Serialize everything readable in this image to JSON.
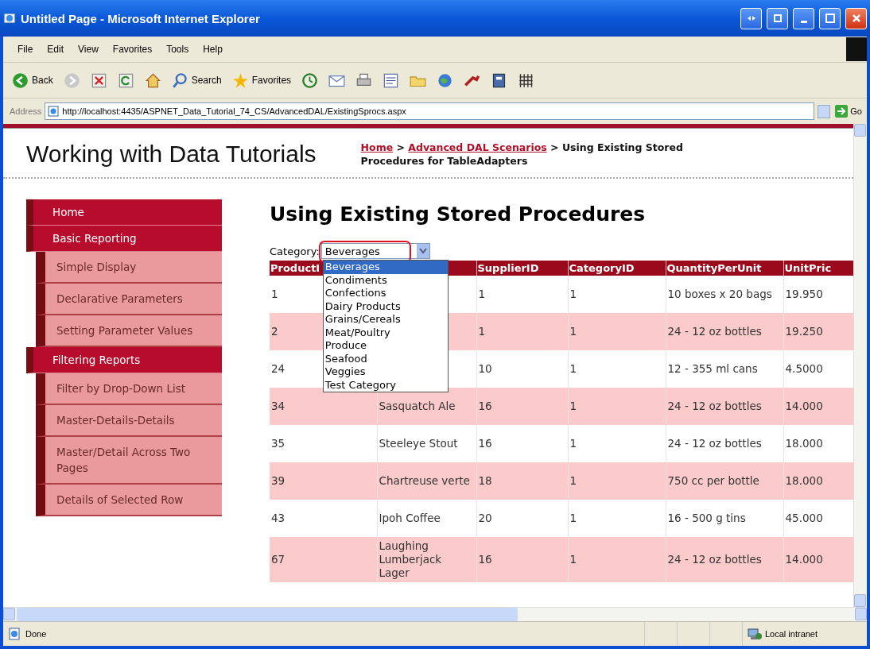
{
  "window": {
    "title": "Untitled Page - Microsoft Internet Explorer"
  },
  "menu": [
    "File",
    "Edit",
    "View",
    "Favorites",
    "Tools",
    "Help"
  ],
  "toolbar": [
    {
      "kind": "back",
      "label": "Back"
    },
    {
      "kind": "forward"
    },
    {
      "kind": "stop"
    },
    {
      "kind": "refresh"
    },
    {
      "kind": "home"
    },
    {
      "kind": "search",
      "label": "Search"
    },
    {
      "kind": "favorites",
      "label": "Favorites"
    },
    {
      "kind": "history"
    },
    {
      "kind": "mail"
    },
    {
      "kind": "print"
    },
    {
      "kind": "edit"
    },
    {
      "kind": "folder"
    },
    {
      "kind": "globe"
    },
    {
      "kind": "tool"
    },
    {
      "kind": "book"
    },
    {
      "kind": "grid"
    }
  ],
  "address": {
    "label": "Address",
    "url": "http://localhost:4435/ASPNET_Data_Tutorial_74_CS/AdvancedDAL/ExistingSprocs.aspx",
    "go": "Go"
  },
  "page": {
    "site_title": "Working with Data Tutorials",
    "breadcrumb": [
      {
        "kind": "link",
        "text": "Home"
      },
      {
        "kind": "text",
        "text": " > "
      },
      {
        "kind": "link",
        "text": "Advanced DAL Scenarios"
      },
      {
        "kind": "text",
        "text": " > Using Existing Stored Procedures for TableAdapters"
      }
    ],
    "sidebar": [
      {
        "label": "Home"
      },
      {
        "label": "Basic Reporting",
        "children": [
          {
            "label": "Simple Display"
          },
          {
            "label": "Declarative Parameters"
          },
          {
            "label": "Setting Parameter Values"
          }
        ]
      },
      {
        "label": "Filtering Reports",
        "children": [
          {
            "label": "Filter by Drop-Down List"
          },
          {
            "label": "Master-Details-Details"
          },
          {
            "label": "Master/Detail Across Two Pages"
          },
          {
            "label": "Details of Selected Row"
          }
        ]
      }
    ],
    "heading": "Using Existing Stored Procedures",
    "filter": {
      "label": "Category:",
      "value": "Beverages",
      "expanded": true,
      "options": [
        {
          "label": "Beverages",
          "selected": true
        },
        {
          "label": "Condiments",
          "selected": false
        },
        {
          "label": "Confections",
          "selected": false
        },
        {
          "label": "Dairy Products",
          "selected": false
        },
        {
          "label": "Grains/Cereals",
          "selected": false
        },
        {
          "label": "Meat/Poultry",
          "selected": false
        },
        {
          "label": "Produce",
          "selected": false
        },
        {
          "label": "Seafood",
          "selected": false
        },
        {
          "label": "Veggies",
          "selected": false
        },
        {
          "label": "Test Category",
          "selected": false
        }
      ]
    },
    "table": {
      "columns": [
        "ProductI",
        null,
        "SupplierID",
        "CategoryID",
        "QuantityPerUnit",
        "UnitPric"
      ],
      "rows": [
        [
          "1",
          null,
          "1",
          "1",
          "10 boxes x 20 bags",
          "19.950"
        ],
        [
          "2",
          null,
          "1",
          "1",
          "24 - 12 oz bottles",
          "19.250"
        ],
        [
          "24",
          null,
          "10",
          "1",
          "12 - 355 ml cans",
          "4.5000"
        ],
        [
          "34",
          "Sasquatch Ale",
          "16",
          "1",
          "24 - 12 oz bottles",
          "14.000"
        ],
        [
          "35",
          "Steeleye Stout",
          "16",
          "1",
          "24 - 12 oz bottles",
          "18.000"
        ],
        [
          "39",
          "Chartreuse verte",
          "18",
          "1",
          "750 cc per bottle",
          "18.000"
        ],
        [
          "43",
          "Ipoh Coffee",
          "20",
          "1",
          "16 - 500 g tins",
          "45.000"
        ],
        [
          "67",
          "Laughing Lumberjack Lager",
          "16",
          "1",
          "24 - 12 oz bottles",
          "14.000"
        ]
      ]
    }
  },
  "status": {
    "text": "Done",
    "zone": "Local intranet"
  }
}
